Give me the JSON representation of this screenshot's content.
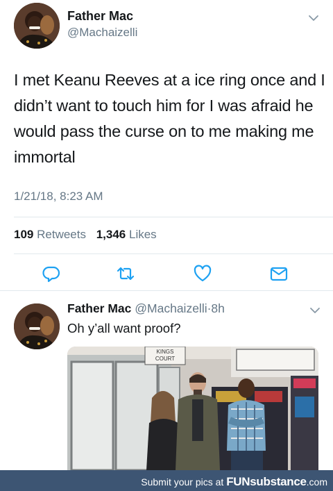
{
  "tweet": {
    "author_name": "Father Mac",
    "handle": "@Machaizelli",
    "text": "I met Keanu Reeves at a ice ring once and I didn’t want to touch him for I was afraid he would pass the curse on to me making me immortal",
    "timestamp": "1/21/18, 8:23 AM",
    "retweets_count": "109",
    "retweets_label": "Retweets",
    "likes_count": "1,346",
    "likes_label": "Likes"
  },
  "reply": {
    "author_name": "Father Mac",
    "handle": "@Machaizelli",
    "separator": "·",
    "age": "8h",
    "text": "Oh y’all want proof?",
    "photo_sign": [
      "KINGS",
      "COURT"
    ]
  },
  "footer": {
    "prompt": "Submit your pics at",
    "brand": "FUNsubstance",
    "tld": ".com"
  },
  "colors": {
    "text": "#14171a",
    "secondary": "#657786",
    "icon": "#1da1f2",
    "footer_bg": "#3d5573"
  }
}
